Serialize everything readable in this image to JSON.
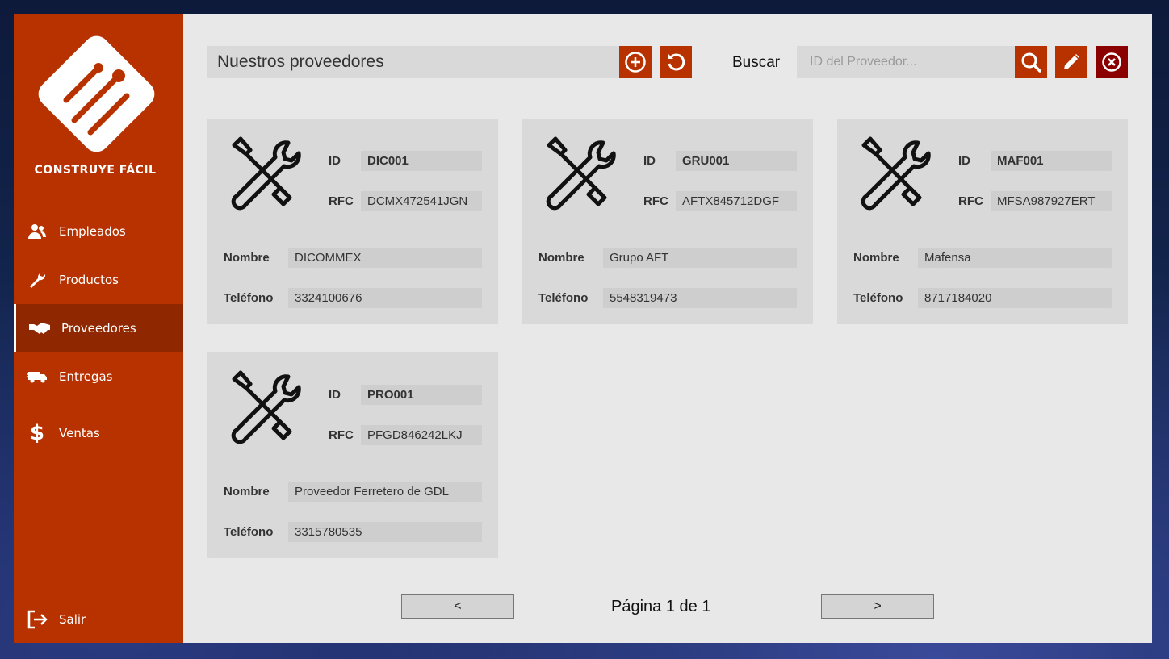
{
  "sidebar": {
    "brand": "CONSTRUYE FÁCIL",
    "items": [
      {
        "label": "Empleados",
        "icon": "users-icon"
      },
      {
        "label": "Productos",
        "icon": "wrench-icon"
      },
      {
        "label": "Proveedores",
        "icon": "handshake-icon",
        "active": true
      },
      {
        "label": "Entregas",
        "icon": "truck-icon"
      },
      {
        "label": "Ventas",
        "icon": "dollar-icon"
      }
    ],
    "logout": "Salir"
  },
  "header": {
    "title": "Nuestros proveedores",
    "search_label": "Buscar",
    "search_placeholder": "ID del Proveedor..."
  },
  "field_labels": {
    "id": "ID",
    "rfc": "RFC",
    "nombre": "Nombre",
    "telefono": "Teléfono"
  },
  "suppliers": [
    {
      "id": "DIC001",
      "rfc": "DCMX472541JGN",
      "nombre": "DICOMMEX",
      "telefono": "3324100676"
    },
    {
      "id": "GRU001",
      "rfc": "AFTX845712DGF",
      "nombre": "Grupo AFT",
      "telefono": "5548319473"
    },
    {
      "id": "MAF001",
      "rfc": "MFSA987927ERT",
      "nombre": "Mafensa",
      "telefono": "8717184020"
    },
    {
      "id": "PRO001",
      "rfc": "PFGD846242LKJ",
      "nombre": "Proveedor Ferretero de GDL",
      "telefono": "3315780535"
    }
  ],
  "pagination": {
    "prev": "<",
    "next": ">",
    "text": "Página 1 de 1"
  },
  "colors": {
    "accent": "#b83200",
    "accent_dark": "#8f2800",
    "danger": "#8b0000",
    "panel": "#e8e8e8",
    "card": "#d9d9d9"
  }
}
